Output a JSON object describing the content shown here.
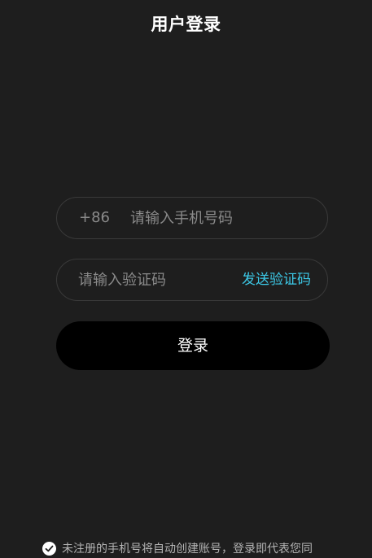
{
  "header": {
    "title": "用户登录"
  },
  "form": {
    "phone": {
      "country_code": "+86",
      "placeholder": "请输入手机号码",
      "value": ""
    },
    "code": {
      "placeholder": "请输入验证码",
      "value": "",
      "send_label": "发送验证码"
    },
    "submit_label": "登录"
  },
  "agreement": {
    "checked": true,
    "text": "未注册的手机号将自动创建账号，登录即代表您同"
  },
  "colors": {
    "background": "#1e1e1e",
    "accent": "#3cc8e6",
    "button": "#000000"
  }
}
